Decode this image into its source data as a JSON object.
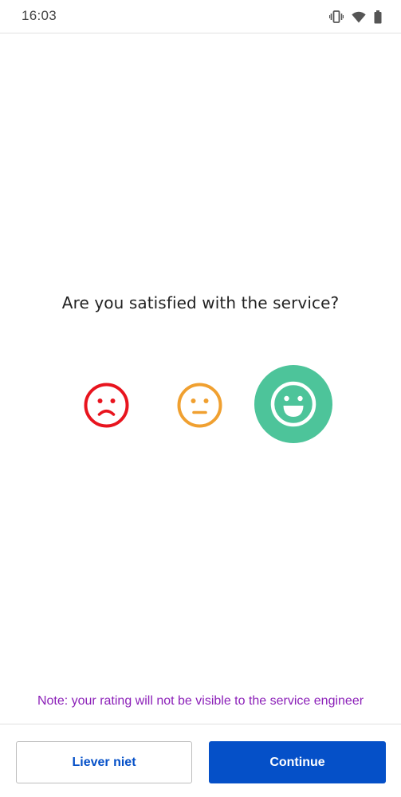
{
  "status_bar": {
    "time": "16:03",
    "icons": [
      "vibrate-icon",
      "wifi-icon",
      "battery-icon"
    ]
  },
  "survey": {
    "question": "Are you satisfied with the service?",
    "options": [
      {
        "name": "dissatisfied",
        "icon": "sad-face-icon",
        "color": "#e8141e",
        "selected": false
      },
      {
        "name": "neutral",
        "icon": "neutral-face-icon",
        "color": "#f0a030",
        "selected": false
      },
      {
        "name": "satisfied",
        "icon": "happy-face-icon",
        "color": "#4dc49a",
        "selected": true
      }
    ],
    "note": "Note: your rating will not be visible to the service engineer"
  },
  "footer": {
    "secondary_label": "Liever niet",
    "primary_label": "Continue"
  },
  "colors": {
    "note_text": "#8b1fb8",
    "primary_button": "#0550c8",
    "secondary_button_text": "#0550c8"
  }
}
